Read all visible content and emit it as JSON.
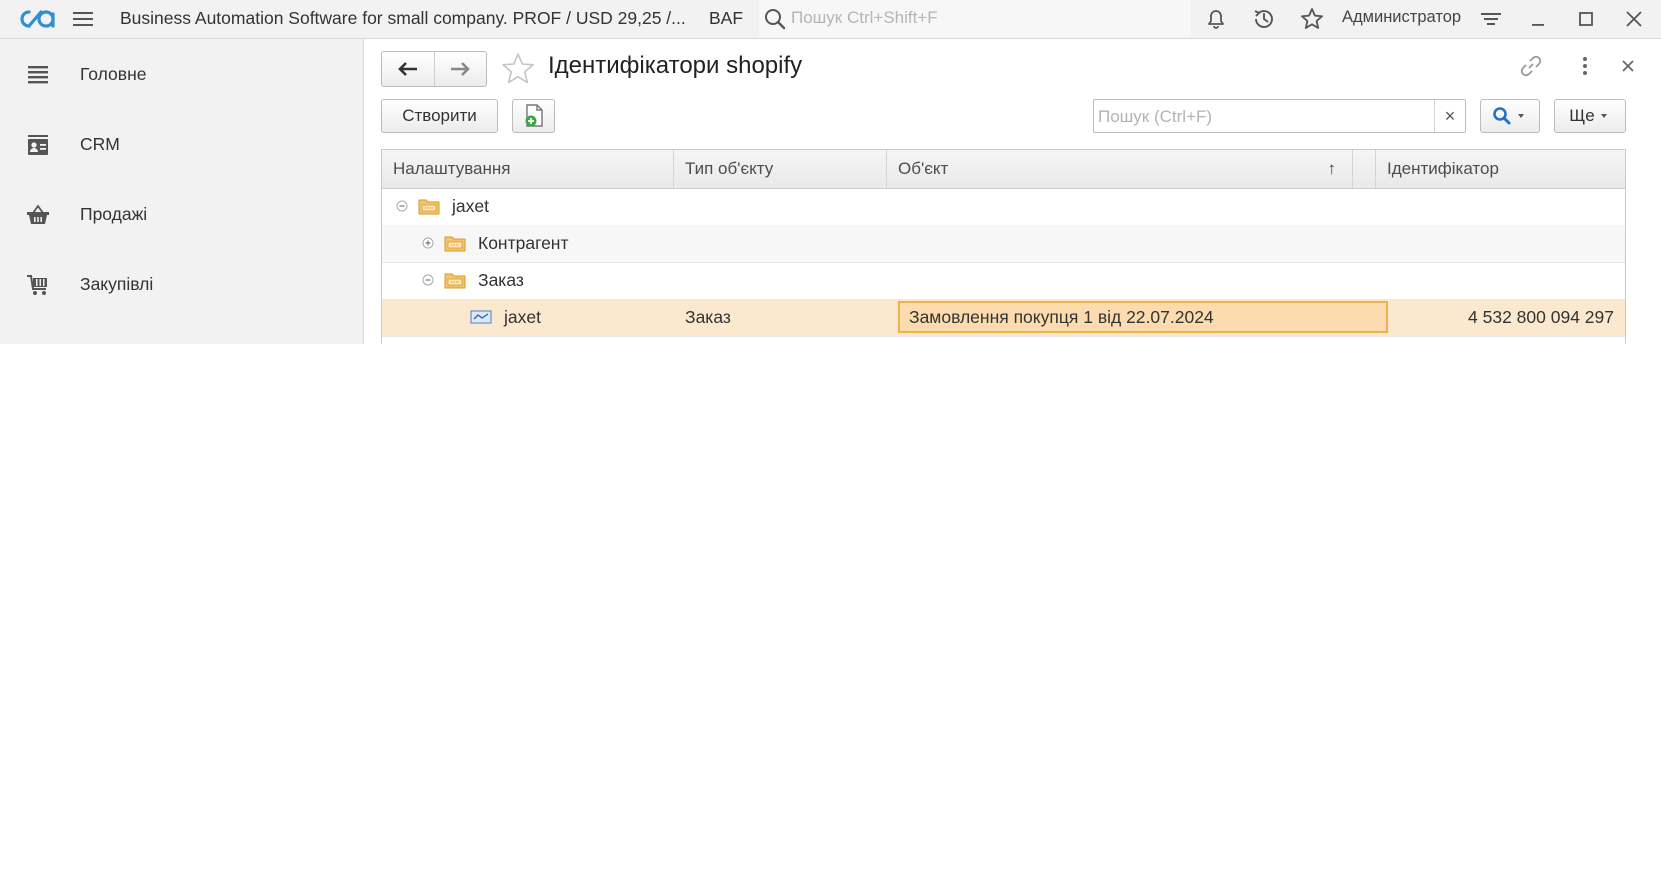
{
  "topbar": {
    "title": "Business Automation Software for small company. PROF / USD 29,25 /...",
    "brand": "BAF",
    "search_placeholder": "Пошук Ctrl+Shift+F",
    "user": "Администратор"
  },
  "sidebar": {
    "items": [
      {
        "label": "Головне",
        "icon": "menu-lines-icon"
      },
      {
        "label": "CRM",
        "icon": "contact-card-icon"
      },
      {
        "label": "Продажі",
        "icon": "basket-icon"
      },
      {
        "label": "Закупівлі",
        "icon": "cart-icon"
      }
    ]
  },
  "page": {
    "title": "Ідентифікатори shopify",
    "create_label": "Створити",
    "search_placeholder": "Пошук (Ctrl+F)",
    "clear_glyph": "×",
    "more_label": "Ще"
  },
  "table": {
    "columns": [
      "Налаштування",
      "Тип об'єкту",
      "Об'єкт",
      "",
      "Ідентифікатор"
    ],
    "sort_glyph": "↑",
    "rows": [
      {
        "level": 0,
        "kind": "group",
        "expanded": true,
        "name": "jaxet",
        "type": "",
        "object": "",
        "identifier": ""
      },
      {
        "level": 1,
        "kind": "group",
        "expanded": false,
        "name": "Контрагент",
        "type": "",
        "object": "",
        "identifier": ""
      },
      {
        "level": 1,
        "kind": "group",
        "expanded": true,
        "name": "Заказ",
        "type": "",
        "object": "",
        "identifier": ""
      },
      {
        "level": 2,
        "kind": "item",
        "name": "jaxet",
        "type": "Заказ",
        "object": "Замовлення покупця 1 від 22.07.2024",
        "identifier": "4 532 800 094 297",
        "selected": true
      }
    ]
  },
  "colors": {
    "selected_row": "#fbe9cf",
    "selected_cell": "#fcdcae",
    "selected_border": "#f0b04a",
    "logo": "#2f8fd3",
    "search_accent": "#1f73c7",
    "add_icon": "#3aa845"
  }
}
